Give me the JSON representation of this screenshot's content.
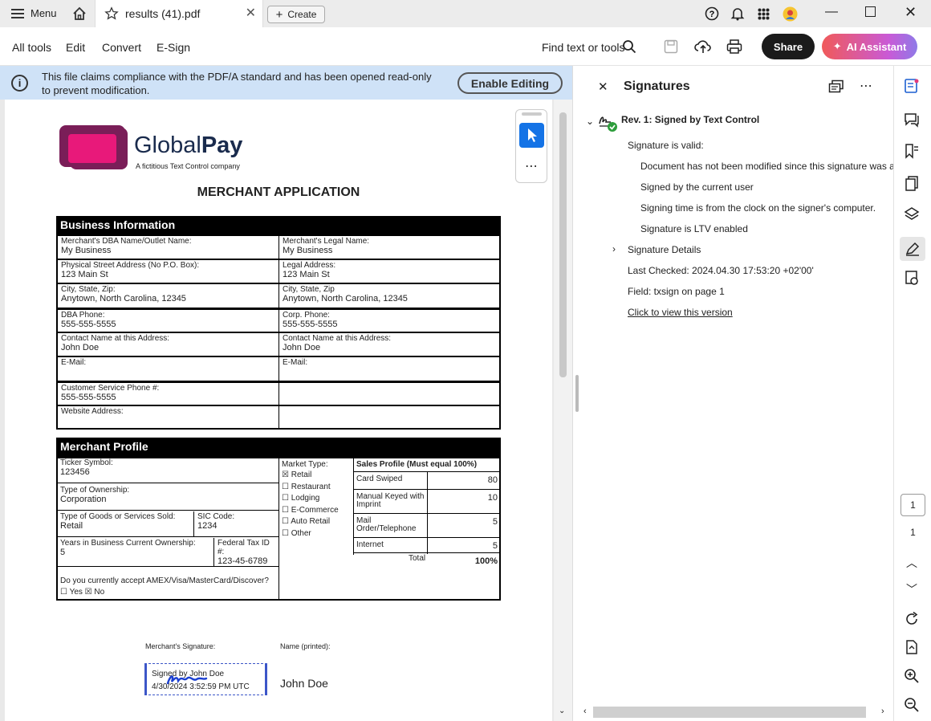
{
  "tabbar": {
    "menu_label": "Menu",
    "tab_title": "results (41).pdf",
    "create_label": "Create"
  },
  "toolbar": {
    "all_tools": "All tools",
    "edit": "Edit",
    "convert": "Convert",
    "esign": "E-Sign",
    "find": "Find text or tools",
    "share": "Share",
    "ai": "AI Assistant"
  },
  "banner": {
    "text": "This file claims compliance with the PDF/A standard and has been opened read-only to prevent modification.",
    "button": "Enable Editing"
  },
  "doc": {
    "logo_name_a": "Global",
    "logo_name_b": "Pay",
    "logo_tagline": "A fictitious Text Control company",
    "heading": "MERCHANT APPLICATION",
    "business_title": "Business Information",
    "business_rows": [
      {
        "l_label": "Merchant's DBA Name/Outlet Name:",
        "l_value": "My Business",
        "r_label": "Merchant's Legal Name:",
        "r_value": "My Business"
      },
      {
        "l_label": "Physical Street Address (No P.O. Box):",
        "l_value": "123 Main St",
        "r_label": "Legal Address:",
        "r_value": "123 Main St"
      },
      {
        "l_label": "City, State, Zip:",
        "l_value": "Anytown, North Carolina, 12345",
        "r_label": "City, State, Zip",
        "r_value": "Anytown, North Carolina, 12345"
      },
      {
        "l_label": "DBA Phone:",
        "l_value": "555-555-5555",
        "r_label": "Corp. Phone:",
        "r_value": "555-555-5555"
      },
      {
        "l_label": "Contact Name at this Address:",
        "l_value": "John Doe",
        "r_label": "Contact Name at this Address:",
        "r_value": "John Doe"
      },
      {
        "l_label": "E-Mail:",
        "l_value": "",
        "r_label": "E-Mail:",
        "r_value": ""
      },
      {
        "l_label": "Customer Service Phone #:",
        "l_value": "555-555-5555",
        "r_label": "",
        "r_value": ""
      },
      {
        "l_label": "Website Address:",
        "l_value": "",
        "r_label": "",
        "r_value": ""
      }
    ],
    "profile_title": "Merchant Profile",
    "ticker_label": "Ticker Symbol:",
    "ticker_value": "123456",
    "ownership_label": "Type of Ownership:",
    "ownership_value": "Corporation",
    "goods_label": "Type of Goods or Services Sold:",
    "goods_value": "Retail",
    "sic_label": "SIC Code:",
    "sic_value": "1234",
    "years_label": "Years in Business Current Ownership:",
    "years_value": "5",
    "taxid_label": "Federal Tax ID #:",
    "taxid_value": "123-45-6789",
    "amex_q": "Do you currently accept AMEX/Visa/MasterCard/Discover?",
    "amex_a": "☐ Yes ☒ No",
    "market_label": "Market Type:",
    "market_options": [
      "☒ Retail",
      "☐ Restaurant",
      "☐ Lodging",
      "☐ E-Commerce",
      "☐ Auto Retail",
      "☐ Other"
    ],
    "sales_title": "Sales Profile (Must equal 100%)",
    "sales_rows": [
      {
        "label": "Card Swiped",
        "value": "80"
      },
      {
        "label": "Manual Keyed with Imprint",
        "value": "10"
      },
      {
        "label": "Mail Order/Telephone",
        "value": "5"
      },
      {
        "label": "Internet",
        "value": "5"
      }
    ],
    "total_label": "Total",
    "total_value": "100%",
    "sig_label": "Merchant's Signature:",
    "name_label": "Name (printed):",
    "sig_line1": "Signed by John Doe",
    "sig_line2": "4/30/2024 3:52:59 PM UTC",
    "printed_name": "John Doe"
  },
  "panel": {
    "title": "Signatures",
    "rev": "Rev. 1: Signed by Text Control",
    "valid": "Signature is valid:",
    "checks": [
      "Document has not been modified since this signature was applied",
      "Signed by the current user",
      "Signing time is from the clock on the signer's computer.",
      "Signature is LTV enabled"
    ],
    "details": "Signature Details",
    "last_checked": "Last Checked: 2024.04.30 17:53:20 +02'00'",
    "field": "Field: txsign on page 1",
    "view_link": "Click to view this version"
  },
  "rail": {
    "page_box": "1",
    "page_total": "1"
  },
  "colors": {
    "accent": "#1473e6",
    "logo_pink": "#e8197a",
    "logo_purple": "#7a1e58",
    "signature_ink": "#1b3fd1"
  }
}
